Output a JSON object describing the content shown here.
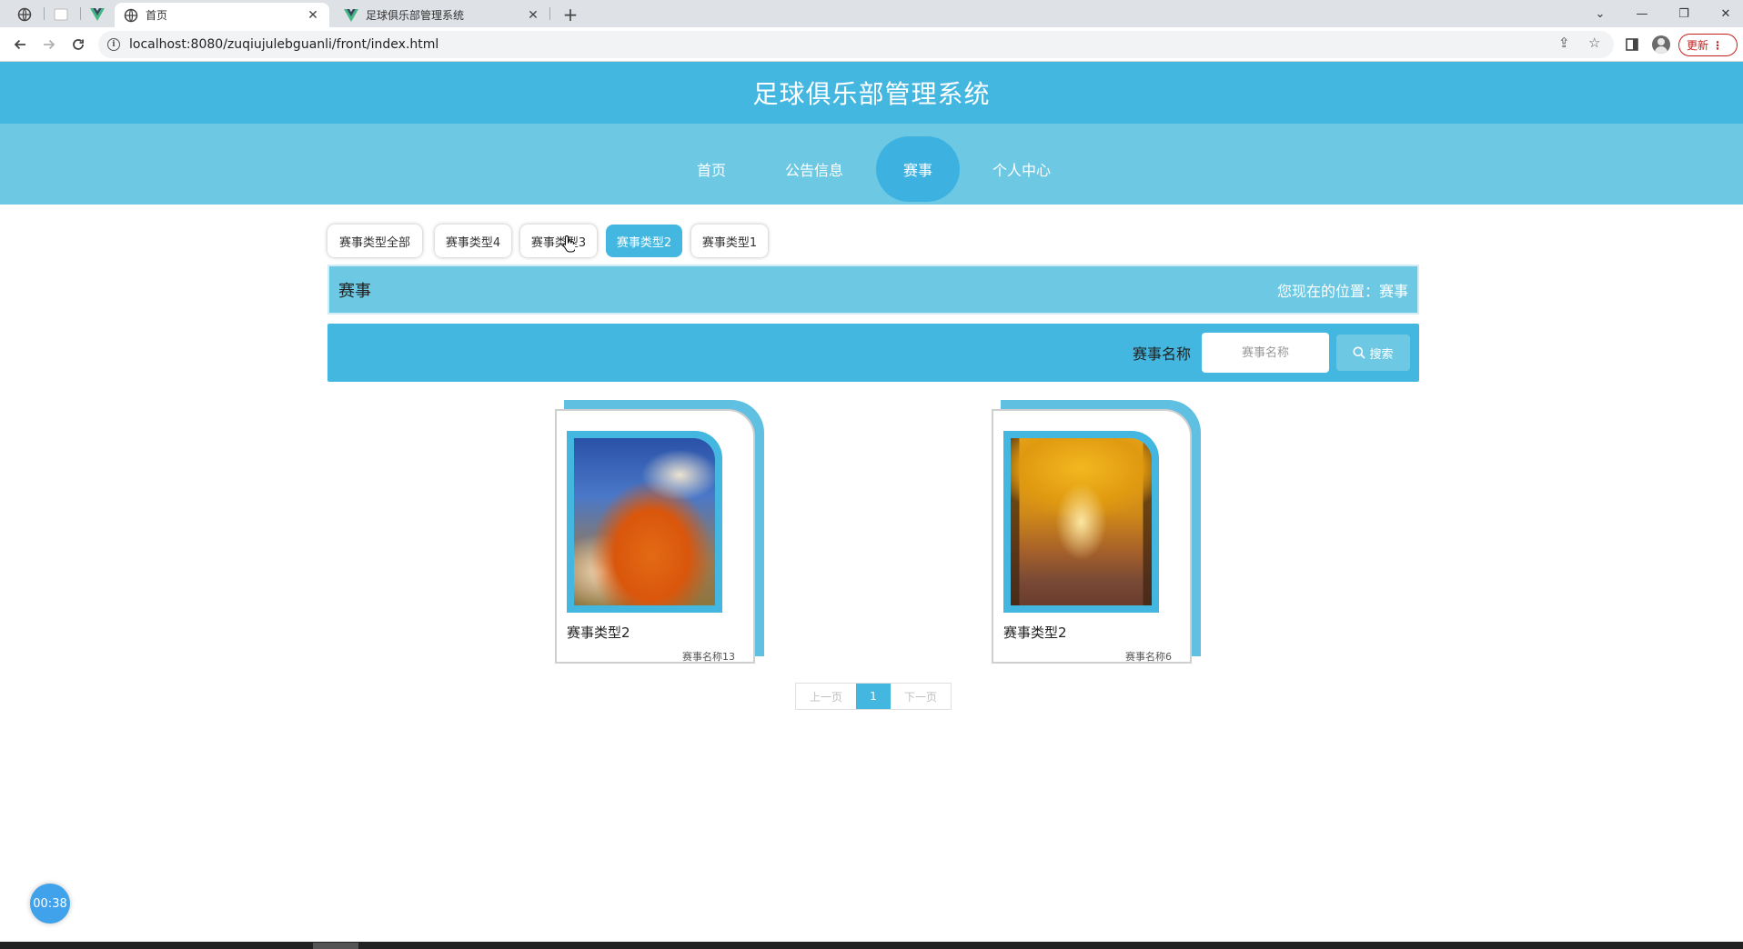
{
  "browser": {
    "tabs": [
      {
        "title": "首页",
        "active": true,
        "icon": "globe-icon"
      },
      {
        "title": "足球俱乐部管理系统",
        "active": false,
        "icon": "vue-logo-icon"
      }
    ],
    "url": "localhost:8080/zuqiujulebguanli/front/index.html",
    "update_label": "更新"
  },
  "site": {
    "title": "足球俱乐部管理系统",
    "nav": [
      {
        "label": "首页",
        "active": false
      },
      {
        "label": "公告信息",
        "active": false
      },
      {
        "label": "赛事",
        "active": true
      },
      {
        "label": "个人中心",
        "active": false
      }
    ]
  },
  "filters": [
    {
      "label": "赛事类型全部",
      "active": false
    },
    {
      "label": "赛事类型4",
      "active": false
    },
    {
      "label": "赛事类型3",
      "active": false
    },
    {
      "label": "赛事类型2",
      "active": true
    },
    {
      "label": "赛事类型1",
      "active": false
    }
  ],
  "location_bar": {
    "title": "赛事",
    "breadcrumb": "您现在的位置：赛事"
  },
  "search": {
    "label": "赛事名称",
    "placeholder": "赛事名称",
    "button_label": "搜索"
  },
  "cards": [
    {
      "title": "赛事类型2",
      "subtitle": "赛事名称13",
      "image": "red-mountain-photo"
    },
    {
      "title": "赛事类型2",
      "subtitle": "赛事名称6",
      "image": "autumn-tree-avenue-photo"
    }
  ],
  "pagination": {
    "prev_label": "上一页",
    "current_page": "1",
    "next_label": "下一页"
  },
  "timer": {
    "value": "00:38"
  },
  "colors": {
    "primary": "#43b7e0",
    "secondary": "#6dc9e3",
    "update_red": "#c5221f"
  }
}
